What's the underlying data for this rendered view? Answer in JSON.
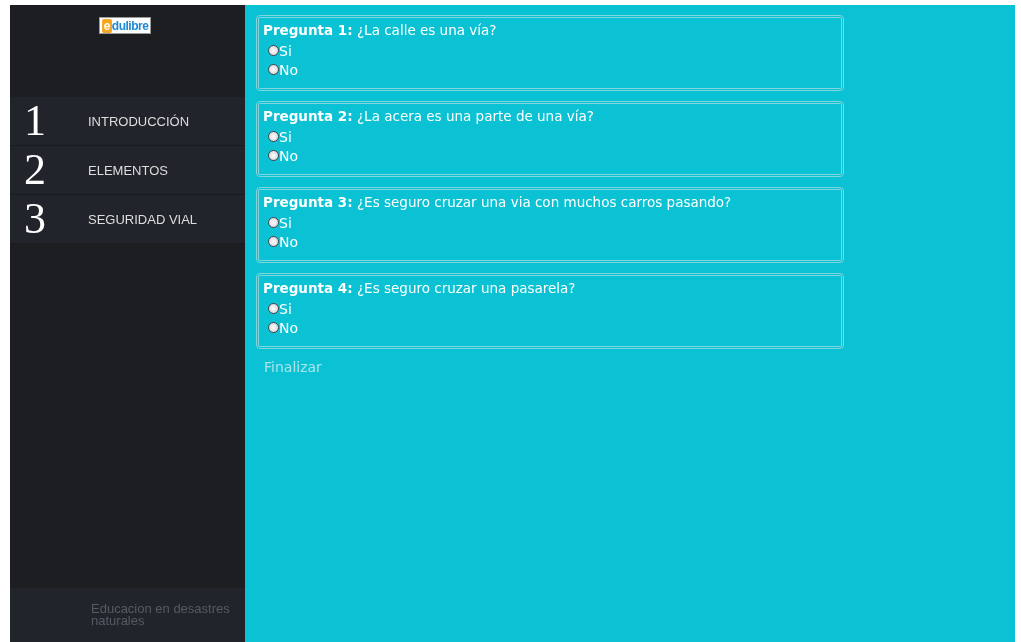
{
  "sidebar": {
    "logo": {
      "mark": "e",
      "name": "dulibre"
    },
    "items": [
      {
        "number": "1",
        "label": "INTRODUCCIÓN"
      },
      {
        "number": "2",
        "label": "ELEMENTOS"
      },
      {
        "number": "3",
        "label": "SEGURIDAD VIAL"
      }
    ],
    "footer": "Educacion en desastres naturales"
  },
  "questions": [
    {
      "text": "**Pregunta 1:** ¿La calle es una vía?",
      "options": [
        {
          "label": "Si",
          "selected": false
        },
        {
          "label": "No",
          "selected": false
        }
      ]
    },
    {
      "text": "**Pregunta 2:** ¿La acera es una parte de una vía?",
      "options": [
        {
          "label": "Si",
          "selected": false
        },
        {
          "label": "No",
          "selected": false
        }
      ]
    },
    {
      "text": "**Pregunta 3:** ¿Es seguro cruzar una via con muchos carros pasando?",
      "options": [
        {
          "label": "Si",
          "selected": false
        },
        {
          "label": "No",
          "selected": false
        }
      ]
    },
    {
      "text": "**Pregunta 4:** ¿Es seguro cruzar una pasarela?",
      "options": [
        {
          "label": "Si",
          "selected": false
        },
        {
          "label": "No",
          "selected": false
        }
      ]
    }
  ],
  "finish": "Finalizar"
}
